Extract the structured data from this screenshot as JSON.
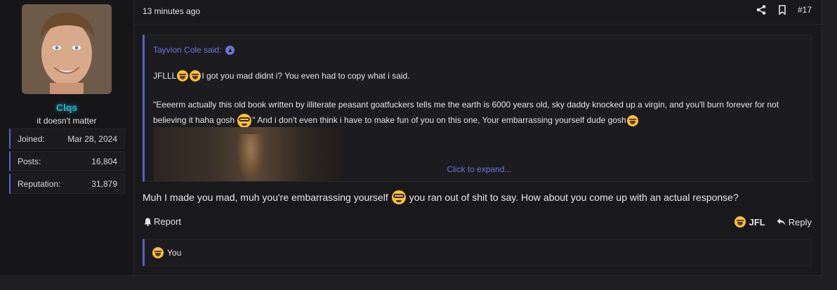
{
  "user": {
    "name": "Clqs",
    "title": "it doesn't matter",
    "stats": [
      {
        "label": "Joined:",
        "value": "Mar 28, 2024"
      },
      {
        "label": "Posts:",
        "value": "16,804"
      },
      {
        "label": "Reputation:",
        "value": "31,879"
      }
    ]
  },
  "post": {
    "time": "13 minutes ago",
    "number": "#17",
    "quote": {
      "author": "Tayvion Cole said:",
      "line1_a": "JFLLL",
      "line1_b": " I got you mad didnt i? You even had to copy what i said.",
      "line2_a": "\"Eeeerm actually this old book written by illiterate peasant goatfuckers tells me the earth is 6000 years old, sky daddy knocked up a virgin, and you'll burn forever for not believing it haha gosh ",
      "line2_b": "\" And i don't even think i have to make fun of you on this one, Your embarrassing yourself dude gosh",
      "expand": "Click to expand..."
    },
    "reply_a": "Muh I made you mad, muh you're embarrassing yourself",
    "reply_b": "you ran out of shit to say. How about you come up with an actual response?",
    "report": "Report",
    "jfl": "JFL",
    "reply": "Reply",
    "reactions": "You"
  },
  "colors": {
    "accent": "#5a5fc7",
    "link": "#6b73d8",
    "username": "#27b3c9"
  }
}
